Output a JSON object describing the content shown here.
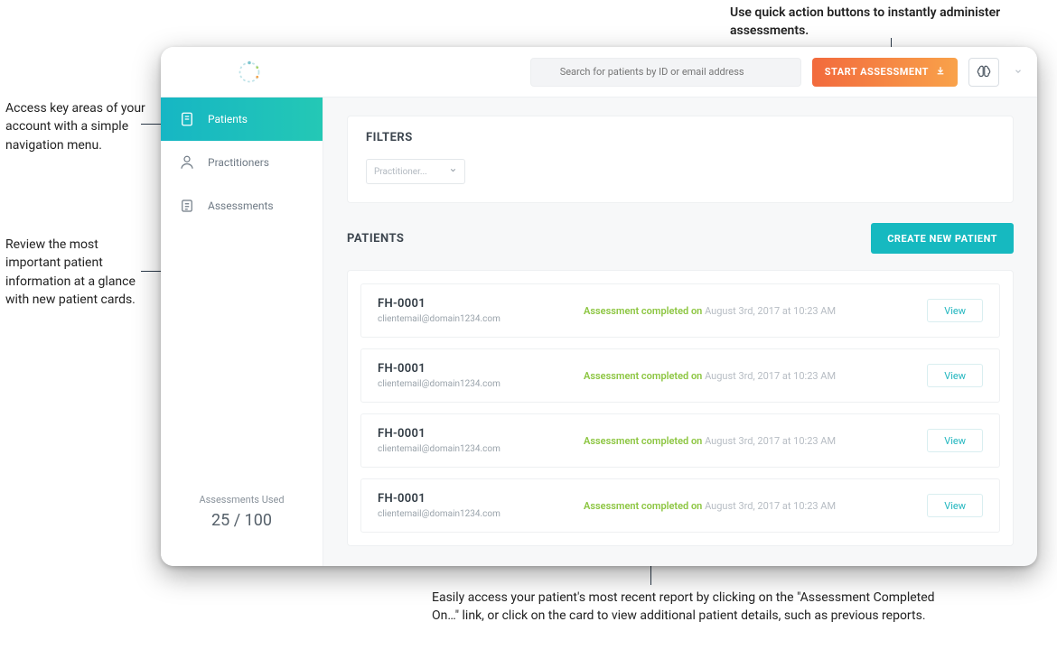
{
  "annotations": {
    "top": "Use quick action buttons to instantly administer assessments.",
    "left1": "Access key areas of your account with a simple navigation menu.",
    "left2": "Review the most important patient information at a glance with new patient cards.",
    "bottom": "Easily access your patient's most recent report by clicking on the \"Assessment Completed On…\" link, or click on the card to view additional patient details, such as previous reports."
  },
  "topbar": {
    "search_placeholder": "Search for patients by ID or email address",
    "start_label": "START ASSESSMENT"
  },
  "sidebar": {
    "items": [
      {
        "label": "Patients"
      },
      {
        "label": "Practitioners"
      },
      {
        "label": "Assessments"
      }
    ],
    "usage_label": "Assessments Used",
    "usage_count": "25 / 100"
  },
  "filters": {
    "title": "FILTERS",
    "practitioner_label": "Practitioner..."
  },
  "patients": {
    "title": "PATIENTS",
    "create_label": "CREATE NEW PATIENT",
    "view_label": "View",
    "rows": [
      {
        "id": "FH-0001",
        "email": "clientemail@domain1234.com",
        "status": "Assessment completed on",
        "date": "August 3rd, 2017 at 10:23 AM"
      },
      {
        "id": "FH-0001",
        "email": "clientemail@domain1234.com",
        "status": "Assessment completed on",
        "date": "August 3rd, 2017 at 10:23 AM"
      },
      {
        "id": "FH-0001",
        "email": "clientemail@domain1234.com",
        "status": "Assessment completed on",
        "date": "August 3rd, 2017 at 10:23 AM"
      },
      {
        "id": "FH-0001",
        "email": "clientemail@domain1234.com",
        "status": "Assessment completed on",
        "date": "August 3rd, 2017 at 10:23 AM"
      }
    ]
  }
}
